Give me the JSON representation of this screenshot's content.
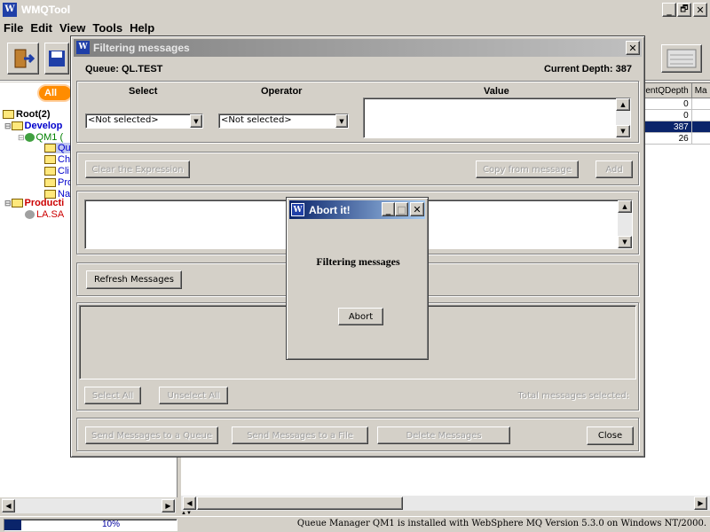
{
  "app": {
    "title": "WMQTool",
    "logo": "W"
  },
  "menu": [
    "File",
    "Edit",
    "View",
    "Tools",
    "Help"
  ],
  "window_controls": {
    "minimize": "_",
    "restore": "🗗",
    "close": "✕"
  },
  "toolbar": {
    "all_queues_label": "All Qu"
  },
  "tree": {
    "root": "Root(2)",
    "develop": "Develop",
    "qm1": "QM1 (",
    "children": [
      "Qu",
      "Ch",
      "Cli",
      "Pro",
      "Na"
    ],
    "production": "Producti",
    "lasa": "LA.SA"
  },
  "grid": {
    "headers": [
      "rentQDepth",
      "Ma"
    ],
    "rows": [
      "0",
      "0",
      "387",
      "26"
    ]
  },
  "status": {
    "progress_text": "10%",
    "progress_value": 0.1,
    "message": "Queue Manager QM1 is installed with WebSphere MQ Version 5.3.0 on Windows NT/2000."
  },
  "filter_dialog": {
    "title": "Filtering messages",
    "close": "✕",
    "queue_label": "Queue: QL.TEST",
    "depth_label": "Current Depth: 387",
    "col_select": "Select",
    "col_operator": "Operator",
    "col_value": "Value",
    "select_value": "<Not selected>",
    "operator_value": "<Not selected>",
    "clear_button": "Clear the Expression",
    "copy_button": "Copy from message",
    "add_button": "Add",
    "refresh_button": "Refresh Messages",
    "select_all": "Select All",
    "unselect_all": "Unselect All",
    "total_selected": "Total messages selected:",
    "send_queue": "Send Messages to a Queue",
    "send_file": "Send Messages to a File",
    "delete_messages": "Delete Messages",
    "close_button": "Close"
  },
  "abort_dialog": {
    "title": "Abort it!",
    "message": "Filtering messages",
    "abort_button": "Abort",
    "controls": {
      "minimize": "_",
      "maximize": "□",
      "close": "✕"
    }
  },
  "colors": {
    "titlebar": "#7a96df",
    "selection": "#0a246a",
    "develop": "#0000cc",
    "production": "#cc0000",
    "orange": "#ff8c00"
  }
}
